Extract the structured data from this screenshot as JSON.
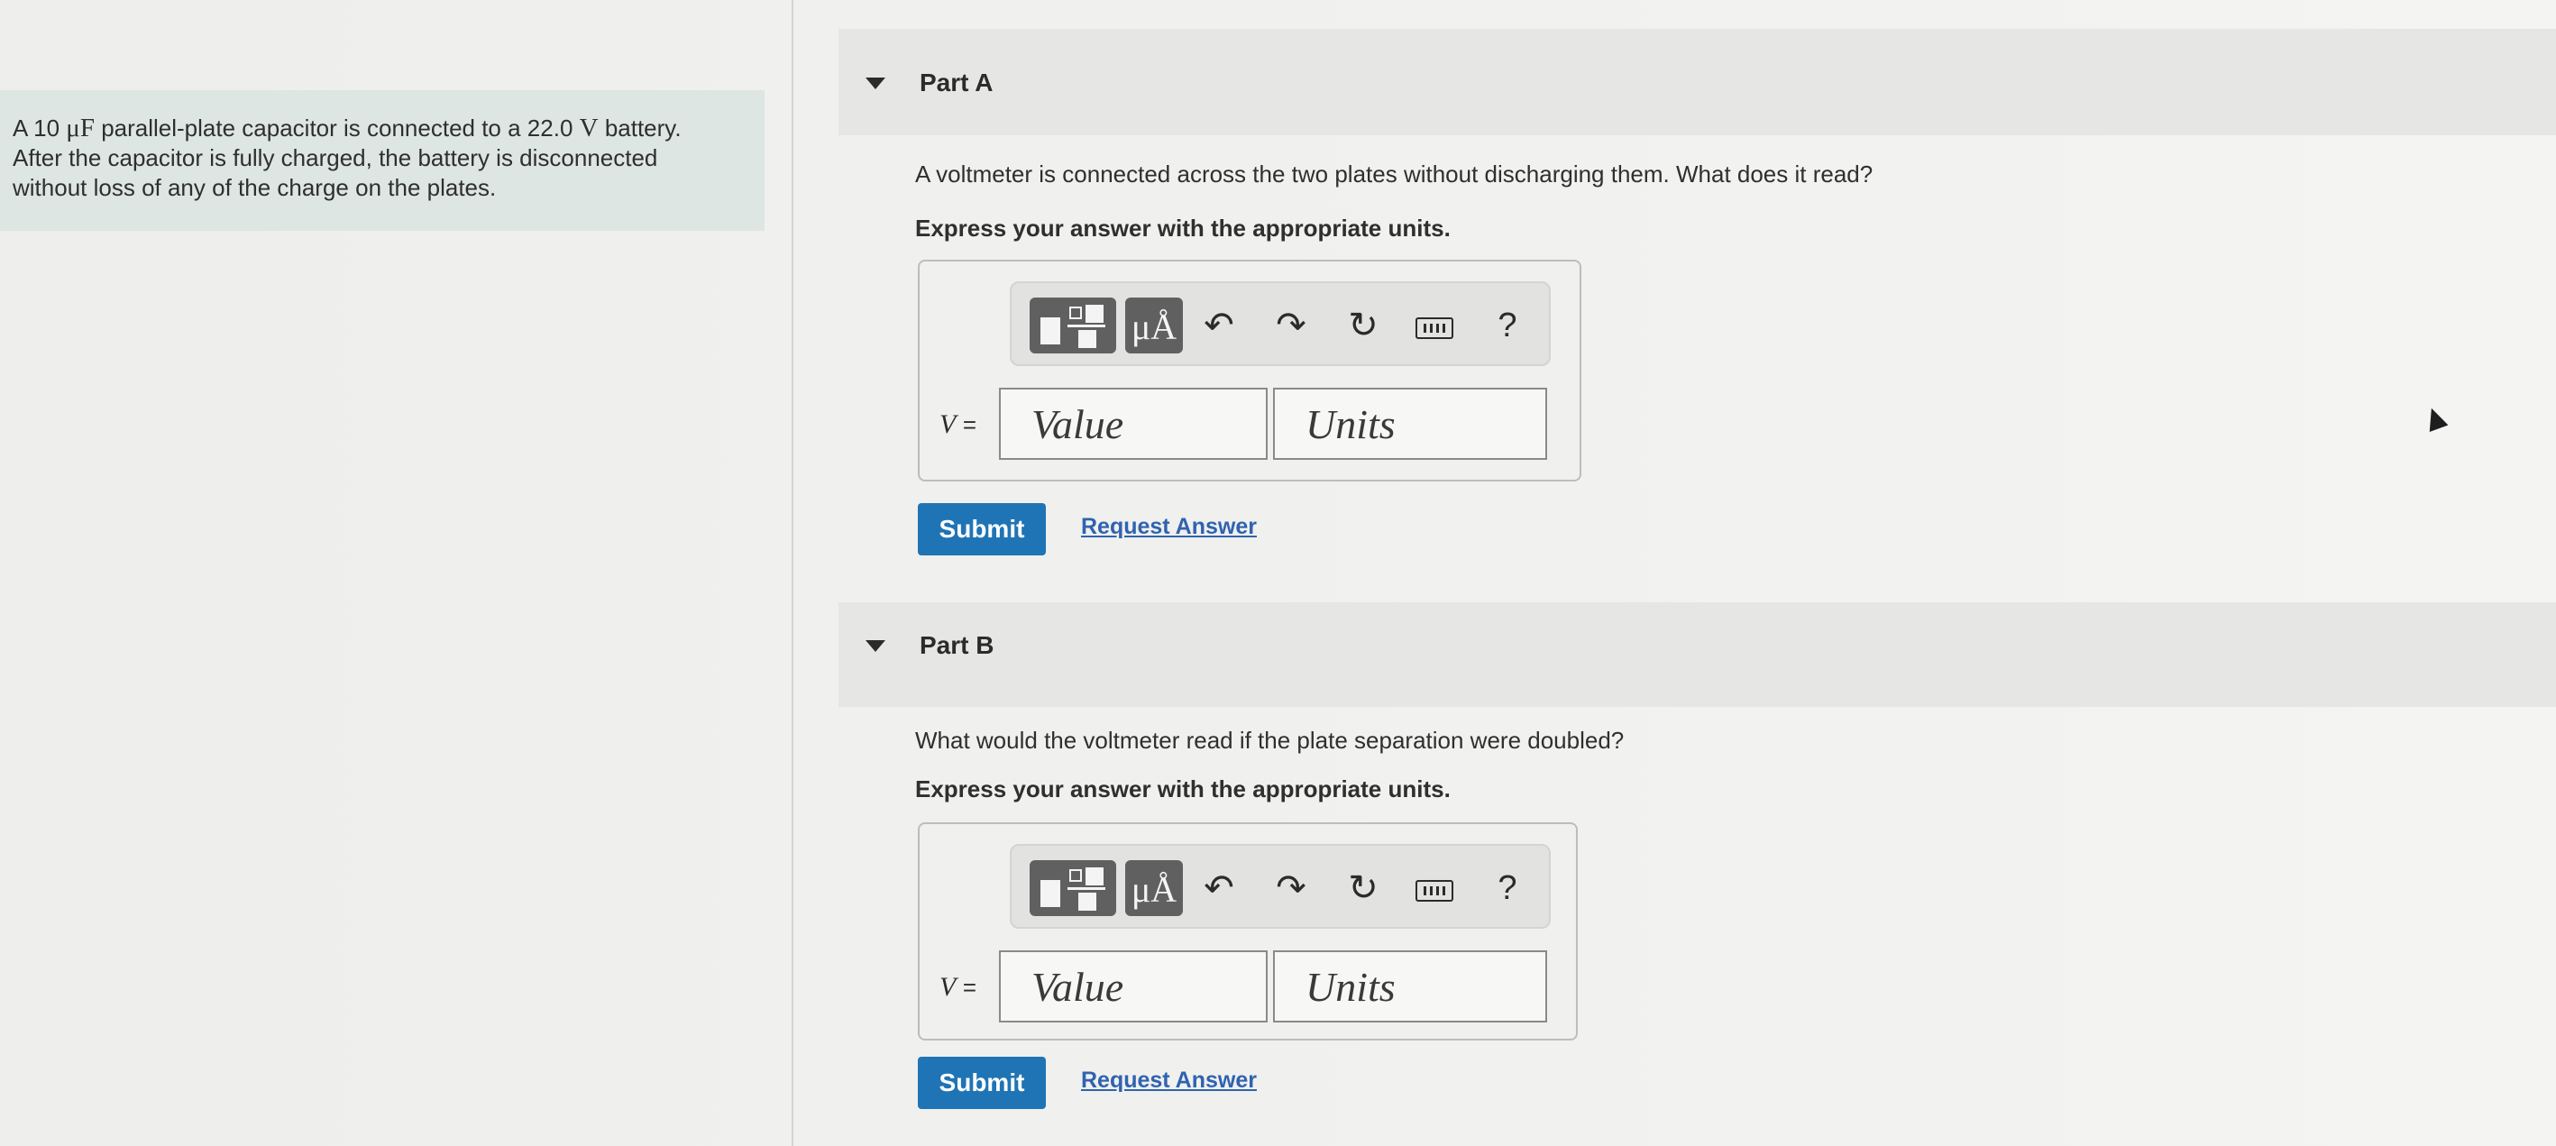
{
  "problem": {
    "text_prefix": "A 10 ",
    "capacitance_unit": "μF",
    "text_mid": " parallel-plate capacitor is connected to a 22.0 ",
    "voltage_unit": "V",
    "text_suffix": " battery.",
    "line2": "After the capacitor is fully charged, the battery is disconnected",
    "line3": "without loss of any of the charge on the plates."
  },
  "part_a": {
    "title": "Part A",
    "question": "A voltmeter is connected across the two plates without discharging them. What does it read?",
    "instruction": "Express your answer with the appropriate units.",
    "variable": "V",
    "equals": "=",
    "value_placeholder": "Value",
    "units_placeholder": "Units",
    "submit_label": "Submit",
    "request_label": "Request Answer"
  },
  "part_b": {
    "title": "Part B",
    "question": "What would the voltmeter read if the plate separation were doubled?",
    "instruction": "Express your answer with the appropriate units.",
    "variable": "V",
    "equals": "=",
    "value_placeholder": "Value",
    "units_placeholder": "Units",
    "submit_label": "Submit",
    "request_label": "Request Answer"
  },
  "toolbar": {
    "units_button_label": "μÅ",
    "undo_glyph": "↶",
    "redo_glyph": "↷",
    "reset_glyph": "↻",
    "help_label": "?",
    "icons": [
      "templates-icon",
      "units-icon",
      "undo-icon",
      "redo-icon",
      "reset-icon",
      "keyboard-icon",
      "help-icon"
    ]
  },
  "colors": {
    "problem_bg": "#dde6e3",
    "submit_bg": "#1f74b5",
    "link": "#2f63b0",
    "header_bg": "#e6e6e4"
  }
}
